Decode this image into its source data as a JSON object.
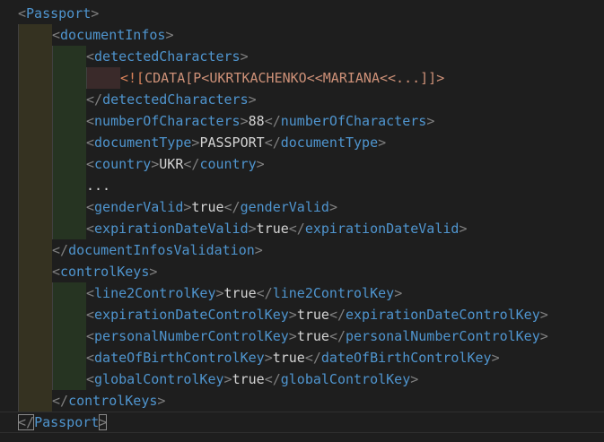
{
  "lines": [
    {
      "indent": 0,
      "open": "Passport"
    },
    {
      "indent": 1,
      "open": "documentInfos"
    },
    {
      "indent": 2,
      "open": "detectedCharacters"
    },
    {
      "indent": 3,
      "cdata_open": "<![",
      "cdata": "CDATA[P<UKRTKACHENKO<<MARIANA<<...]]>"
    },
    {
      "indent": 2,
      "close": "detectedCharacters"
    },
    {
      "indent": 2,
      "open": "numberOfCharacters",
      "value": "88",
      "close": "numberOfCharacters"
    },
    {
      "indent": 2,
      "open": "documentType",
      "value": "PASSPORT",
      "close": "documentType"
    },
    {
      "indent": 2,
      "open": "country",
      "value": "UKR",
      "close": "country"
    },
    {
      "indent": 2,
      "text": "..."
    },
    {
      "indent": 2,
      "open": "genderValid",
      "value": "true",
      "close": "genderValid"
    },
    {
      "indent": 2,
      "open": "expirationDateValid",
      "value": "true",
      "close": "expirationDateValid"
    },
    {
      "indent": 1,
      "close": "documentInfosValidation"
    },
    {
      "indent": 1,
      "open": "controlKeys"
    },
    {
      "indent": 2,
      "open": "line2ControlKey",
      "value": "true",
      "close": "line2ControlKey"
    },
    {
      "indent": 2,
      "open": "expirationDateControlKey",
      "value": "true",
      "close": "expirationDateControlKey"
    },
    {
      "indent": 2,
      "open": "personalNumberControlKey",
      "value": "true",
      "close": "personalNumberControlKey"
    },
    {
      "indent": 2,
      "open": "dateOfBirthControlKey",
      "value": "true",
      "close": "dateOfBirthControlKey"
    },
    {
      "indent": 2,
      "open": "globalControlKey",
      "value": "true",
      "close": "globalControlKey"
    },
    {
      "indent": 1,
      "close": "controlKeys"
    },
    {
      "indent": 0,
      "close": "Passport",
      "current": true
    }
  ]
}
